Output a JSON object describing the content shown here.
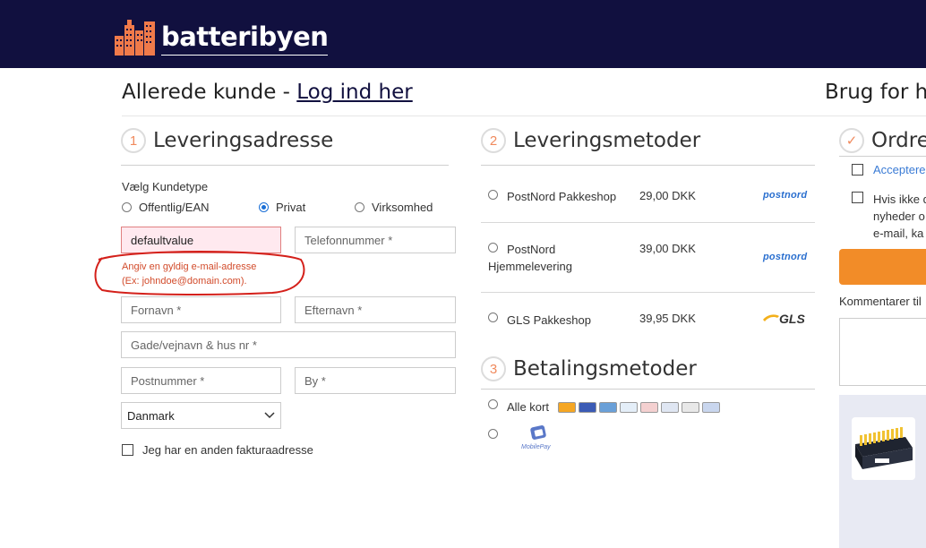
{
  "header": {
    "logo_text": "batteribyen"
  },
  "login": {
    "prefix": "Allerede kunde - ",
    "link": "Log ind her",
    "right_text": "Brug for hj"
  },
  "delivery_address": {
    "step": "1",
    "title": "Leveringsadresse",
    "customer_type_label": "Vælg Kundetype",
    "customer_types": [
      {
        "label": "Offentlig/EAN",
        "selected": false
      },
      {
        "label": "Privat",
        "selected": true
      },
      {
        "label": "Virksomhed",
        "selected": false
      }
    ],
    "email_value": "defaultvalue",
    "phone_placeholder": "Telefonnummer *",
    "error_line1": "Angiv en gyldig e-mail-adresse",
    "error_line2": "(Ex: johndoe@domain.com).",
    "firstname_placeholder": "Fornavn *",
    "lastname_placeholder": "Efternavn *",
    "street_placeholder": "Gade/vejnavn & hus nr *",
    "zip_placeholder": "Postnummer *",
    "city_placeholder": "By *",
    "country": "Danmark",
    "invoice_checkbox": "Jeg har en anden fakturaadresse"
  },
  "shipping": {
    "step": "2",
    "title": "Leveringsmetoder",
    "methods": [
      {
        "name": "PostNord Pakkeshop",
        "price": "29,00 DKK",
        "brand": "postnord"
      },
      {
        "name_line1": "PostNord",
        "name_line2": "Hjemmelevering",
        "price": "39,00 DKK",
        "brand": "postnord"
      },
      {
        "name": "GLS Pakkeshop",
        "price": "39,95 DKK",
        "brand": "GLS"
      }
    ]
  },
  "payment": {
    "step": "3",
    "title": "Betalingsmetoder",
    "methods": [
      {
        "name": "Alle kort"
      },
      {
        "name": "MobilePay"
      }
    ]
  },
  "order": {
    "step": "✓",
    "title": "Ordre",
    "accept_link": "Acceptere",
    "newsletter_line1": "Hvis ikke d",
    "newsletter_line2": "nyheder o",
    "newsletter_line3": "e-mail, ka",
    "comments_label": "Kommentarer til"
  },
  "colors": {
    "header_bg": "#11103f",
    "accent": "#f08a5d",
    "error": "#d24b2b",
    "button": "#f28c28",
    "link": "#3a7bd5"
  }
}
